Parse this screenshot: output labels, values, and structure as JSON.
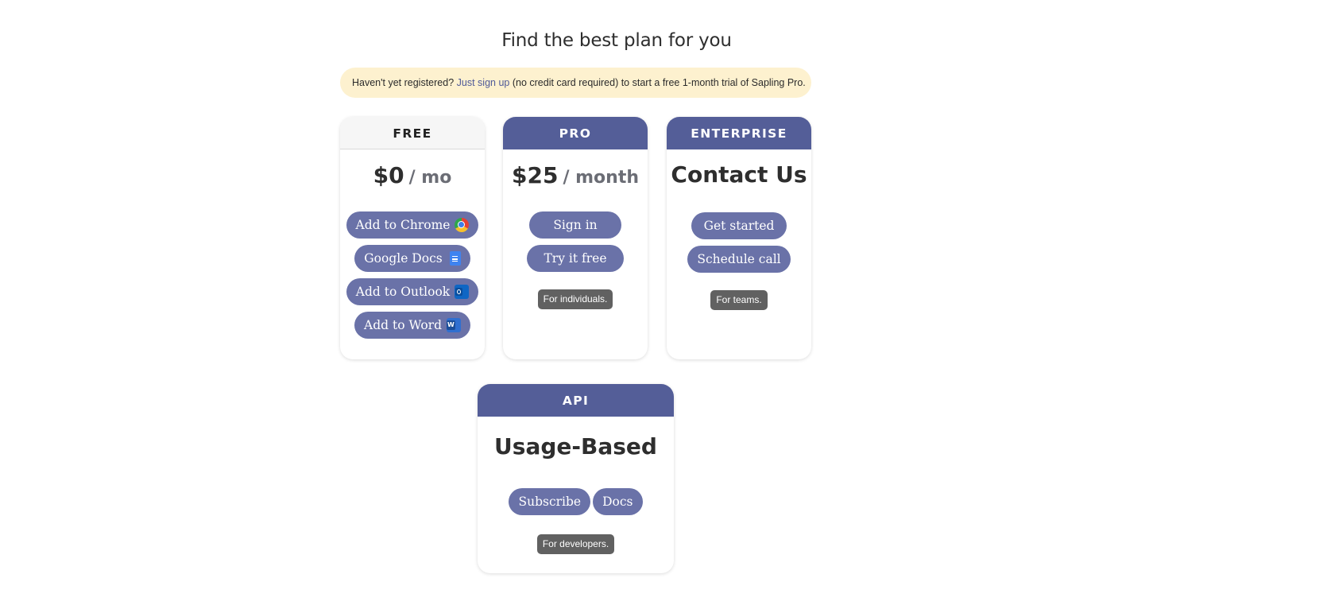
{
  "page": {
    "title": "Find the best plan for you"
  },
  "notice": {
    "prefix": "Haven't yet registered?",
    "link": "Just sign up",
    "suffix": "(no credit card required) to start a free 1-month trial of Sapling Pro."
  },
  "plans": {
    "free": {
      "name": "FREE",
      "price": "$0",
      "period": "/ mo",
      "buttons": {
        "chrome": "Add to Chrome",
        "docs": "Google Docs",
        "outlook": "Add to Outlook",
        "word": "Add to Word"
      }
    },
    "pro": {
      "name": "PRO",
      "price": "$25",
      "period": "/ month",
      "buttons": {
        "signin": "Sign in",
        "trial": "Try it free"
      },
      "tag": "For individuals."
    },
    "enterprise": {
      "name": "ENTERPRISE",
      "price": "Contact Us",
      "buttons": {
        "started": "Get started",
        "schedule": "Schedule call"
      },
      "tag": "For teams."
    },
    "api": {
      "name": "API",
      "price": "Usage-Based",
      "buttons": {
        "subscribe": "Subscribe",
        "docs": "Docs"
      },
      "tag": "For developers."
    }
  },
  "icons": {
    "chrome": "chrome-icon",
    "docs": "google-docs-icon",
    "outlook": "outlook-icon",
    "word": "word-icon"
  },
  "colors": {
    "accent": "#545e98",
    "button": "#6a72a8",
    "notice_bg": "#fdf1cf",
    "tag_bg": "#616161"
  }
}
